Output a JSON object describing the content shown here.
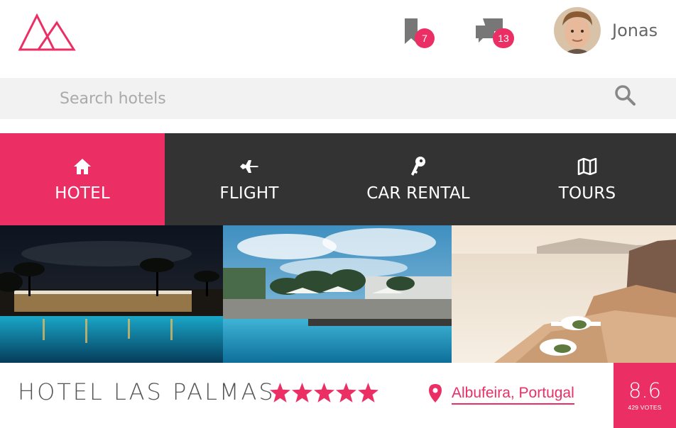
{
  "header": {
    "logo_icon": "triangle-logo",
    "bookmarks": {
      "icon": "bookmark-icon",
      "count": "7"
    },
    "messages": {
      "icon": "chat-icon",
      "count": "13"
    },
    "user": {
      "name": "Jonas",
      "avatar": "user-avatar"
    }
  },
  "search": {
    "placeholder": "Search hotels",
    "icon": "magnifying-glass-icon"
  },
  "nav": {
    "tabs": [
      {
        "label": "HOTEL",
        "icon": "home-icon",
        "active": true
      },
      {
        "label": "FLIGHT",
        "icon": "airplane-icon",
        "active": false
      },
      {
        "label": "CAR RENTAL",
        "icon": "key-icon",
        "active": false
      },
      {
        "label": "TOURS",
        "icon": "map-icon",
        "active": false
      }
    ]
  },
  "gallery": {
    "photos": [
      "hotel-night-pool-photo",
      "hotel-day-pool-photo",
      "seaside-terrace-photo"
    ]
  },
  "hotel": {
    "name": "HOTEL LAS PALMAS",
    "stars": 5,
    "location": "Albufeira, Portugal",
    "rating": "8.6",
    "votes": "429 VOTES"
  },
  "colors": {
    "accent": "#eb2f64",
    "nav_bg": "#333333",
    "search_bg": "#f2f2f2"
  }
}
